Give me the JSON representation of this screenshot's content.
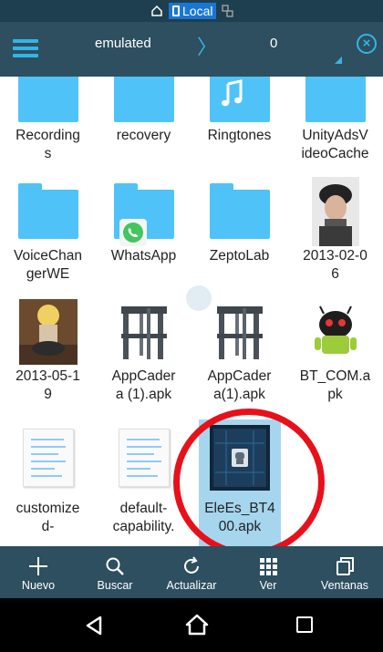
{
  "status_bar": {
    "location_label": "Local"
  },
  "toolbar": {
    "path_segment": "emulated",
    "path_separator": "〉",
    "item_count": "0"
  },
  "files": [
    {
      "name": "Recordings",
      "label_lines": [
        "Recording",
        "s"
      ],
      "kind": "folder"
    },
    {
      "name": "recovery",
      "label_lines": [
        "recovery"
      ],
      "kind": "folder"
    },
    {
      "name": "Ringtones",
      "label_lines": [
        "Ringtones"
      ],
      "kind": "folder-music"
    },
    {
      "name": "UnityAdsVideoCache",
      "label_lines": [
        "UnityAdsV",
        "ideoCache"
      ],
      "kind": "folder"
    },
    {
      "name": "VoiceChangerWE",
      "label_lines": [
        "VoiceChan",
        "gerWE"
      ],
      "kind": "folder"
    },
    {
      "name": "WhatsApp",
      "label_lines": [
        "WhatsApp"
      ],
      "kind": "folder-whatsapp"
    },
    {
      "name": "ZeptoLab",
      "label_lines": [
        "ZeptoLab"
      ],
      "kind": "folder"
    },
    {
      "name": "2013-02-06",
      "label_lines": [
        "2013-02-0",
        "6"
      ],
      "kind": "photo-person"
    },
    {
      "name": "2013-05-19",
      "label_lines": [
        "2013-05-1",
        "9"
      ],
      "kind": "photo-figure"
    },
    {
      "name": "AppCadera (1).apk",
      "label_lines": [
        "AppCader",
        "a (1).apk"
      ],
      "kind": "stool"
    },
    {
      "name": "AppCadera(1).apk",
      "label_lines": [
        "AppCader",
        "a(1).apk"
      ],
      "kind": "stool"
    },
    {
      "name": "BT_COM.apk",
      "label_lines": [
        "BT_COM.a",
        "pk"
      ],
      "kind": "android"
    },
    {
      "name": "customized-",
      "label_lines": [
        "customize",
        "d-"
      ],
      "kind": "doc"
    },
    {
      "name": "default-capability.",
      "label_lines": [
        "default-",
        "capability."
      ],
      "kind": "doc"
    },
    {
      "name": "EleEs_BT400.apk",
      "label_lines": [
        "EleEs_BT4",
        "00.apk"
      ],
      "kind": "chip",
      "selected": true
    }
  ],
  "actions": [
    {
      "label": "Nuevo",
      "icon": "plus-icon"
    },
    {
      "label": "Buscar",
      "icon": "search-icon"
    },
    {
      "label": "Actualizar",
      "icon": "refresh-icon"
    },
    {
      "label": "Ver",
      "icon": "grid-icon"
    },
    {
      "label": "Ventanas",
      "icon": "windows-icon"
    }
  ],
  "colors": {
    "toolbar_bg": "#2d4f5f",
    "accent": "#33b5e5",
    "folder": "#4fc3f7",
    "selection": "#a6d6ee",
    "highlight_ring": "#e8101a"
  }
}
